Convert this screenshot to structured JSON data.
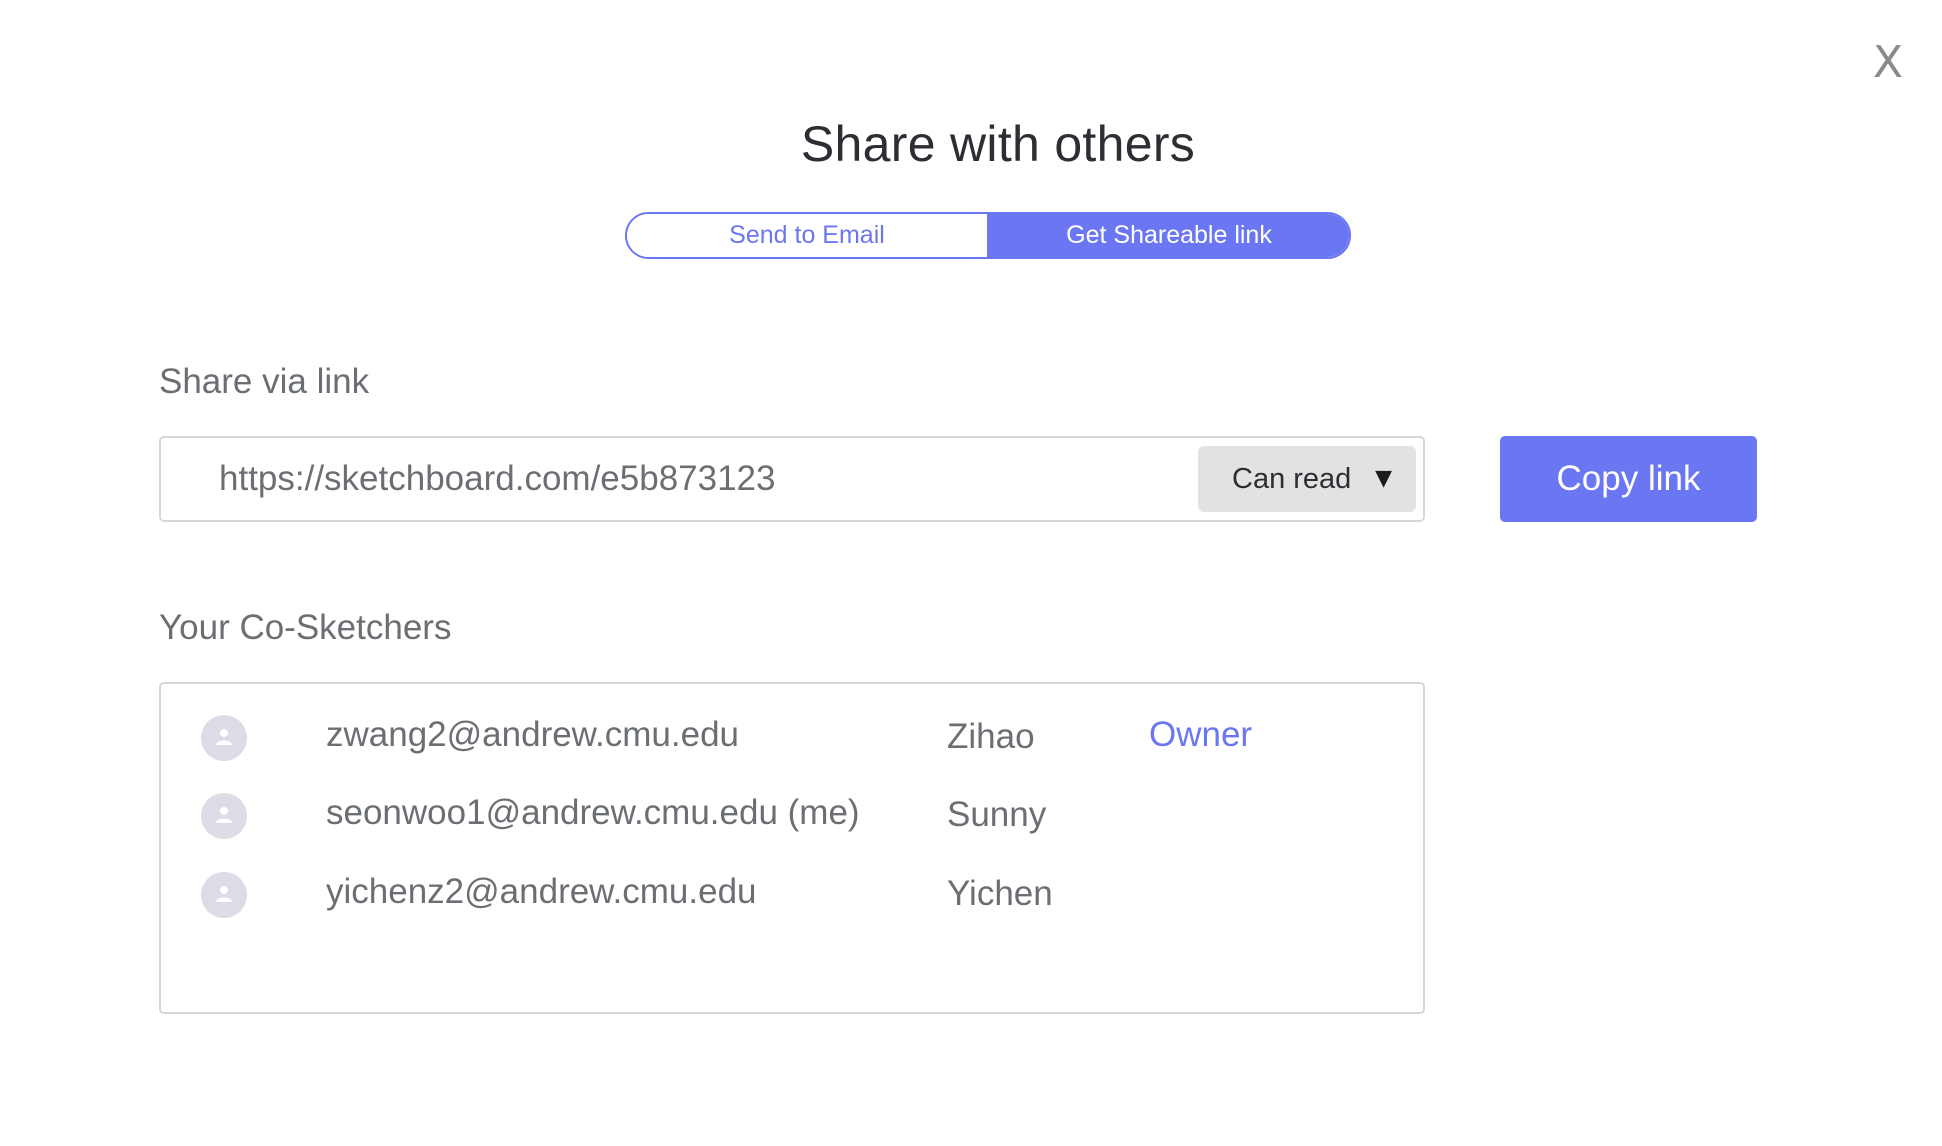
{
  "dialog": {
    "close_label": "X",
    "title": "Share with others"
  },
  "tabs": [
    {
      "label": "Send to Email",
      "active": false
    },
    {
      "label": "Get Shareable link",
      "active": true
    }
  ],
  "share_link": {
    "section_label": "Share via link",
    "url": "https://sketchboard.com/e5b873123",
    "permission": "Can read",
    "caret": "▼",
    "copy_label": "Copy link"
  },
  "co_sketchers": {
    "section_label": "Your Co-Sketchers",
    "rows": [
      {
        "email": "zwang2@andrew.cmu.edu",
        "name": "Zihao",
        "role": "Owner"
      },
      {
        "email": "seonwoo1@andrew.cmu.edu (me)",
        "name": "Sunny",
        "role": ""
      },
      {
        "email": "yichenz2@andrew.cmu.edu",
        "name": "Yichen",
        "role": ""
      }
    ]
  },
  "colors": {
    "accent": "#6b76f2",
    "text": "#6b6f73",
    "title": "#2b2f33",
    "border": "#d6d6d6",
    "avatar_bg": "#dcdbe6"
  }
}
